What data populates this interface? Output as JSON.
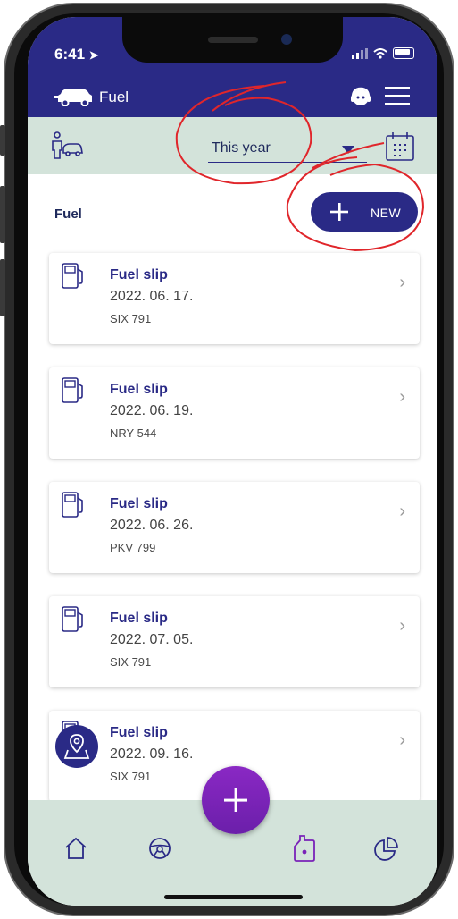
{
  "status_bar": {
    "time": "6:41"
  },
  "header": {
    "title": "Fuel"
  },
  "filter": {
    "period": "This year"
  },
  "section": {
    "title": "Fuel",
    "new_button": "NEW"
  },
  "entries": [
    {
      "title": "Fuel slip",
      "date": "2022. 06. 17.",
      "plate": "SIX 791"
    },
    {
      "title": "Fuel slip",
      "date": "2022. 06. 19.",
      "plate": "NRY 544"
    },
    {
      "title": "Fuel slip",
      "date": "2022. 06. 26.",
      "plate": "PKV 799"
    },
    {
      "title": "Fuel slip",
      "date": "2022. 07. 05.",
      "plate": "SIX 791"
    },
    {
      "title": "Fuel slip",
      "date": "2022. 09. 16.",
      "plate": "SIX 791"
    }
  ],
  "nav": {
    "items": [
      "home-icon",
      "steering-wheel-icon",
      "fuel-can-icon",
      "pie-chart-icon"
    ],
    "active": "fuel-can-icon"
  },
  "colors": {
    "primary": "#2a2a86",
    "accent": "#7a22b8",
    "bar_bg": "#d3e3da",
    "annotation": "#e0262b"
  }
}
